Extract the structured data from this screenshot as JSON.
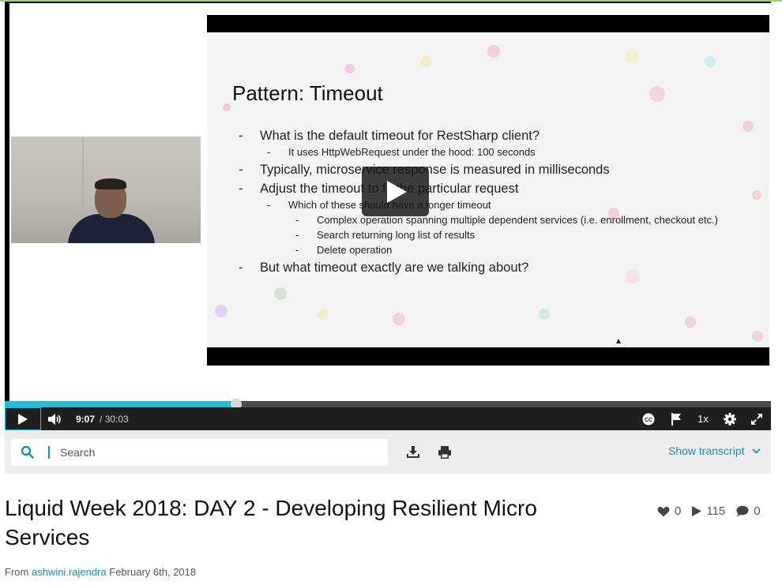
{
  "player": {
    "slide": {
      "title": "Pattern: Timeout",
      "bullets": [
        {
          "level": 1,
          "text": "What is the default timeout for RestSharp client?"
        },
        {
          "level": 2,
          "text": "It uses HttpWebRequest under the hood: 100 seconds"
        },
        {
          "level": 1,
          "text": "Typically, microservice response is measured in milliseconds"
        },
        {
          "level": 1,
          "text": "Adjust the timeout to fit the particular request"
        },
        {
          "level": 2,
          "text": "Which of these should have a longer timeout"
        },
        {
          "level": 3,
          "text": "Complex operation spanning multiple dependent services (i.e. enrollment, checkout etc.)"
        },
        {
          "level": 3,
          "text": "Search returning long list of results"
        },
        {
          "level": 3,
          "text": "Delete operation"
        },
        {
          "level": 1,
          "text": "But what timeout exactly are we talking about?"
        }
      ]
    },
    "progress_fraction": 0.302,
    "current_time": "9:07",
    "total_time": "/ 30:03",
    "speed_label": "1x",
    "accent_color": "#2cb9d3"
  },
  "toolbar": {
    "search_placeholder": "Search",
    "show_transcript_label": "Show transcript"
  },
  "video": {
    "title": "Liquid Week 2018: DAY 2 - Developing Resilient Micro Services",
    "likes": "0",
    "plays": "115",
    "comments": "0",
    "from_label": "From",
    "author": "ashwini.rajendra",
    "date": "February 6th, 2018"
  },
  "icons": [
    "play-icon",
    "volume-icon",
    "closed-captions-icon",
    "flag-icon",
    "settings-gear-icon",
    "fullscreen-icon",
    "search-icon",
    "download-icon",
    "print-icon",
    "chevron-down-icon",
    "heart-icon",
    "comment-icon"
  ]
}
